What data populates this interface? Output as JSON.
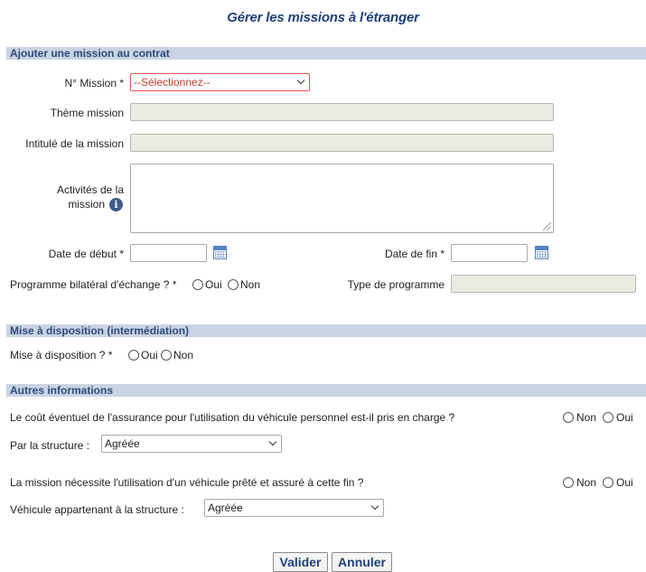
{
  "page": {
    "title": "Gérer les missions à l'étranger"
  },
  "section_add": {
    "header": "Ajouter une mission au contrat",
    "mission_no_label": "N° Mission *",
    "mission_no_value": "--Sélectionnez--",
    "theme_label": "Thème mission",
    "intitule_label": "Intitulé de la mission",
    "activites_label_1": "Activités de la",
    "activites_label_2": "mission",
    "date_debut_label": "Date de début *",
    "date_fin_label": "Date de fin *",
    "programme_label": "Programme bilatéral d'échange ? *",
    "oui": "Oui",
    "non": "Non",
    "type_programme_label": "Type de programme"
  },
  "section_mad": {
    "header": "Mise à disposition (intermédiation)",
    "mad_label": "Mise à disposition ? *",
    "oui": "Oui",
    "non": "Non"
  },
  "section_autres": {
    "header": "Autres informations",
    "q1": "Le coût éventuel de l'assurance pour l'utilisation du véhicule personnel est-il pris en charge ?",
    "q1_non": "Non",
    "q1_oui": "Oui",
    "par_structure_label": "Par la structure :",
    "par_structure_value": "Agréée",
    "q2": "La mission nécessite l'utilisation d'un véhicule prêté et assuré à cette fin ?",
    "q2_non": "Non",
    "q2_oui": "Oui",
    "vehicule_label": "Véhicule appartenant à la structure :",
    "vehicule_value": "Agréée"
  },
  "buttons": {
    "valider": "Valider",
    "annuler": "Annuler"
  }
}
